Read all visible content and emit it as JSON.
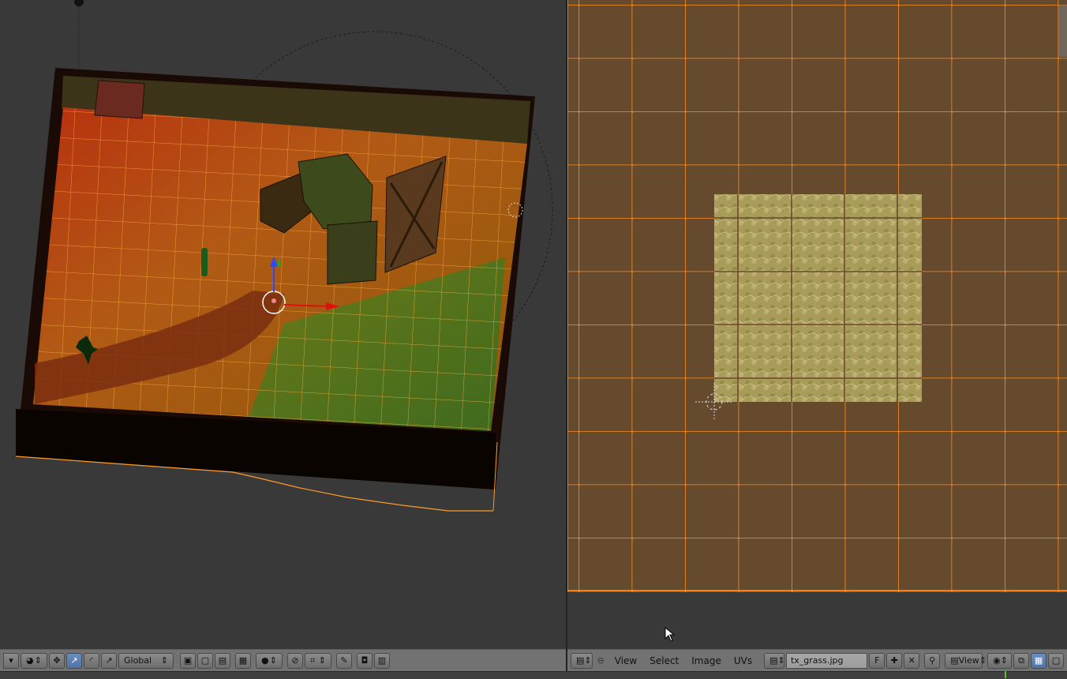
{
  "left_header": {
    "transform_orientation": "Global"
  },
  "uv_header": {
    "menus": [
      "View",
      "Select",
      "Image",
      "UVs"
    ],
    "image_name": "tx_grass.jpg",
    "fake_user": "F",
    "view_mode": "View"
  },
  "colors": {
    "uv_background": "#654a2e",
    "uv_grid_line": "#ff8c1e",
    "selection": "#ff9a2a",
    "header_bg": "#727272",
    "area_bg": "#393939"
  },
  "icons": [
    "editor-type-icon",
    "pivot-icon",
    "manipulator-icon",
    "translate-icon",
    "rotate-icon",
    "scale-icon",
    "layer-icon",
    "proportional-icon",
    "snap-icon",
    "render-icon",
    "image-icon",
    "sticky-icon",
    "cursor-icon"
  ]
}
